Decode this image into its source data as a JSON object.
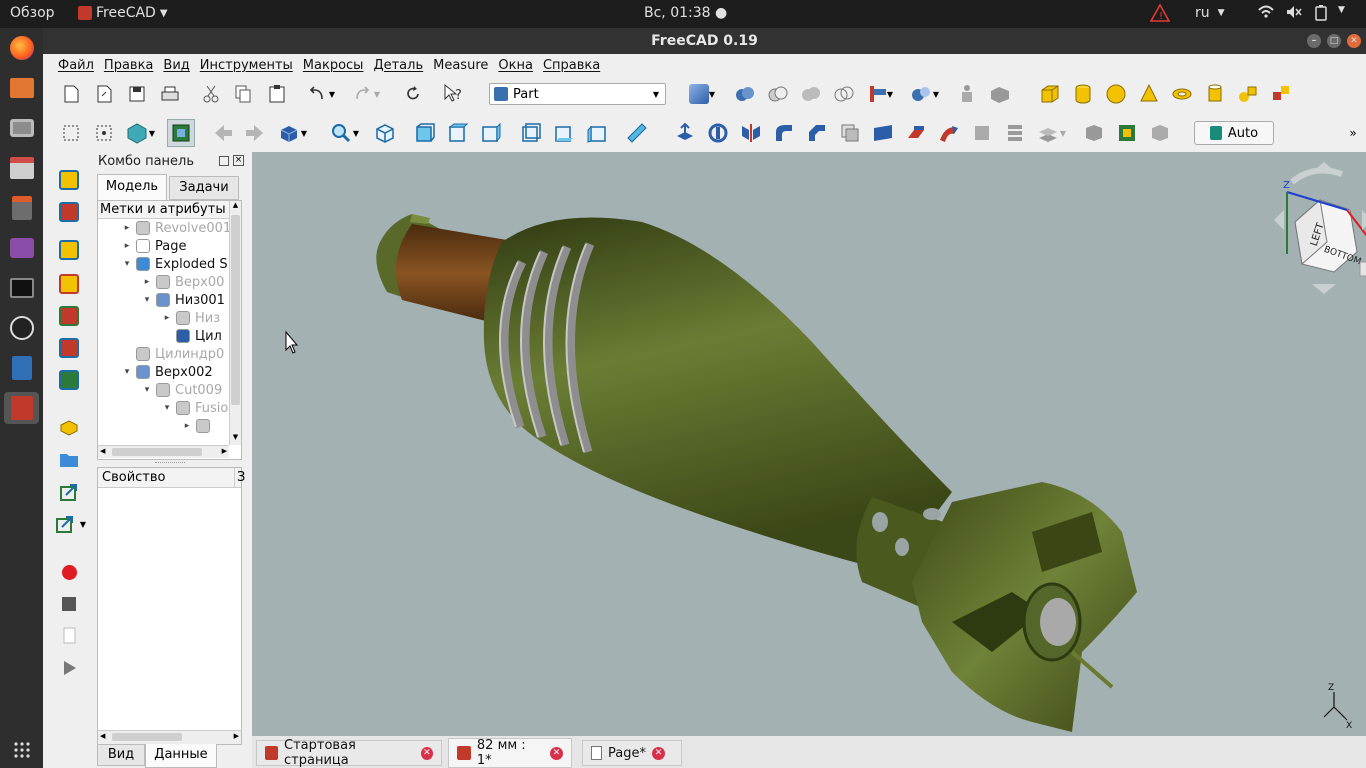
{
  "topbar": {
    "overview": "Обзор",
    "app": "FreeCAD",
    "clock": "Вс, 01:38 ●",
    "lang": "ru"
  },
  "window": {
    "title": "FreeCAD 0.19"
  },
  "menu": [
    "Файл",
    "Правка",
    "Вид",
    "Инструменты",
    "Макросы",
    "Деталь",
    "Measure",
    "Окна",
    "Справка"
  ],
  "workbench": {
    "label": "Part"
  },
  "toolbar2": {
    "auto_label": "Auto"
  },
  "combo": {
    "title": "Комбо панель",
    "tab_model": "Модель",
    "tab_tasks": "Задачи",
    "tree_header": "Метки и атрибуты",
    "prop_header": "Свойство",
    "prop_col2": "З",
    "tab_view": "Вид",
    "tab_data": "Данные"
  },
  "tree": [
    {
      "label": "Revolve001",
      "muted": true,
      "indent": 0,
      "tri": "▸"
    },
    {
      "label": "Page",
      "muted": false,
      "indent": 0,
      "tri": "▸"
    },
    {
      "label": "Exploded S",
      "muted": false,
      "indent": 0,
      "tri": "▾"
    },
    {
      "label": "Верх00",
      "muted": true,
      "indent": 1,
      "tri": "▸"
    },
    {
      "label": "Низ001",
      "muted": false,
      "indent": 1,
      "tri": "▾"
    },
    {
      "label": "Низ",
      "muted": true,
      "indent": 2,
      "tri": "▸"
    },
    {
      "label": "Цил",
      "muted": false,
      "indent": 2,
      "tri": ""
    },
    {
      "label": "Цилиндр0",
      "muted": true,
      "indent": 0,
      "tri": ""
    },
    {
      "label": "Верх002",
      "muted": false,
      "indent": 0,
      "tri": "▾"
    },
    {
      "label": "Cut009",
      "muted": true,
      "indent": 1,
      "tri": "▾"
    },
    {
      "label": "Fusio",
      "muted": true,
      "indent": 2,
      "tri": "▾"
    },
    {
      "label": "",
      "muted": true,
      "indent": 3,
      "tri": "▸"
    }
  ],
  "navcube": {
    "face1": "LEFT",
    "face2": "BOTTOM",
    "axis_x": "X",
    "axis_z": "Z"
  },
  "tabs": [
    {
      "label": "Стартовая страница"
    },
    {
      "label": "82 мм : 1*"
    },
    {
      "label": "Page*"
    }
  ],
  "colors": {
    "viewport": "#a3b1b2",
    "body": "#5a6b2c",
    "fuse": "#7b4a1e",
    "band": "#9a9a9a",
    "accent": "#d9304a"
  }
}
